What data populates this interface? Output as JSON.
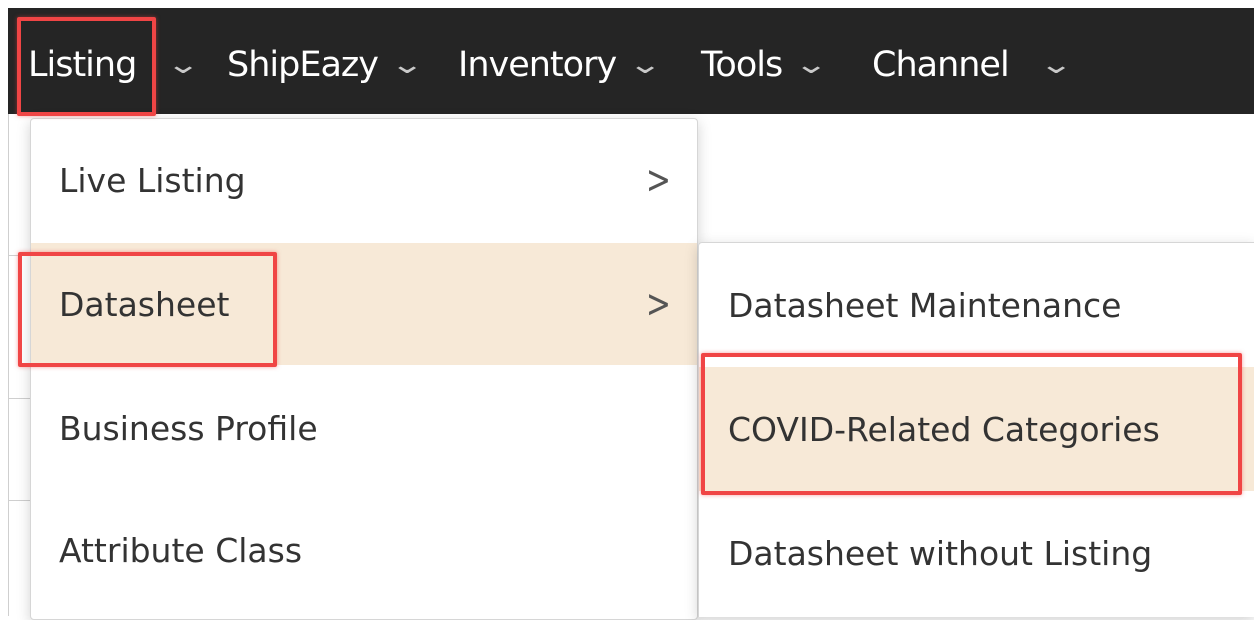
{
  "nav": {
    "items": [
      {
        "label": "Listing"
      },
      {
        "label": "ShipEazy"
      },
      {
        "label": "Inventory"
      },
      {
        "label": "Tools"
      },
      {
        "label": "Channel"
      }
    ],
    "chevron": "chevron-down-icon"
  },
  "menu": {
    "items": [
      {
        "label": "Live Listing",
        "has_submenu": true
      },
      {
        "label": "Datasheet",
        "has_submenu": true,
        "active": true
      },
      {
        "label": "Business Profile"
      },
      {
        "label": "Attribute Class"
      }
    ],
    "arrow_glyph": ">"
  },
  "submenu": {
    "items": [
      {
        "label": "Datasheet Maintenance"
      },
      {
        "label": "COVID-Related Categories",
        "active": true
      },
      {
        "label": "Datasheet without Listing"
      }
    ]
  },
  "colors": {
    "navbar_bg": "#252525",
    "active_bg": "#f7e9d7",
    "highlight": "#f04545"
  }
}
